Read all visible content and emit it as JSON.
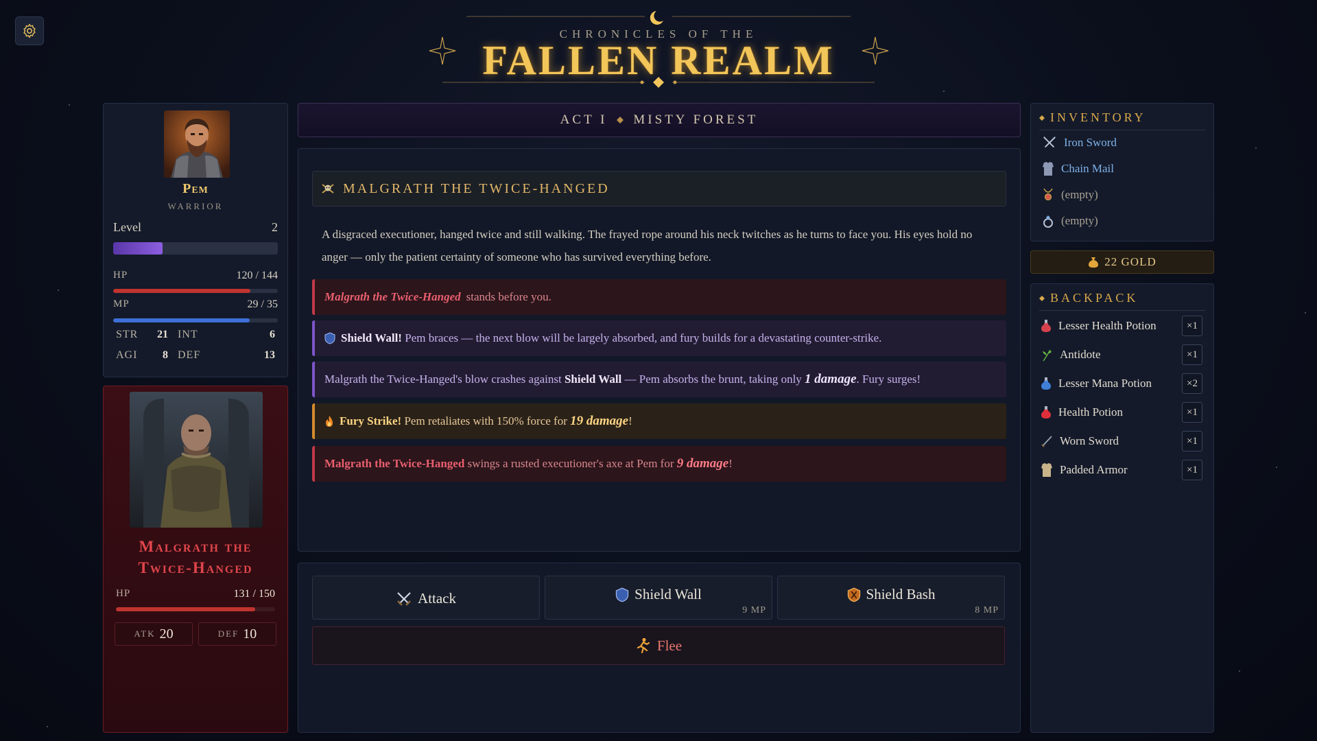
{
  "header": {
    "subtitle": "CHRONICLES OF THE",
    "title": "FALLEN REALM"
  },
  "location": {
    "act": "ACT I",
    "place": "MISTY FOREST"
  },
  "player": {
    "name": "Pem",
    "class": "WARRIOR",
    "level_label": "Level",
    "level": "2",
    "xp_fraction": 0.3,
    "hp_label": "HP",
    "hp_text": "120 / 144",
    "hp_fraction": 0.833,
    "mp_label": "MP",
    "mp_text": "29 / 35",
    "mp_fraction": 0.829,
    "stats": {
      "str_label": "STR",
      "str": "21",
      "int_label": "INT",
      "int": "6",
      "agi_label": "AGI",
      "agi": "8",
      "def_label": "DEF",
      "def": "13"
    }
  },
  "enemy": {
    "name_line1": "Malgrath the",
    "name_line2": "Twice-Hanged",
    "hp_label": "HP",
    "hp_text": "131 / 150",
    "hp_fraction": 0.873,
    "atk_label": "ATK",
    "atk": "20",
    "def_label": "DEF",
    "def": "10"
  },
  "combat": {
    "enemy_title": "MALGRATH THE TWICE-HANGED",
    "description": "A disgraced executioner, hanged twice and still walking. The frayed rope around his neck twitches as he turns to face you. His eyes hold no anger — only the patient certainty of someone who has survived everything before.",
    "log": {
      "l1_name": "Malgrath the Twice-Hanged",
      "l1_rest": "stands before you.",
      "l2_bold": "Shield Wall!",
      "l2_rest": "Pem braces — the next blow will be largely absorbed, and fury builds for a devastating counter-strike.",
      "l3_a": "Malgrath the Twice-Hanged's blow crashes against",
      "l3_bold": "Shield Wall",
      "l3_b": "— Pem absorbs the brunt, taking only",
      "l3_dmg": "1 damage",
      "l3_c": ". Fury surges!",
      "l4_bold": "Fury Strike!",
      "l4_a": "Pem retaliates with 150% force for",
      "l4_dmg": "19 damage",
      "l4_c": "!",
      "l5_name": "Malgrath the Twice-Hanged",
      "l5_a": "swings a rusted executioner's axe at Pem for",
      "l5_dmg": "9 damage",
      "l5_c": "!"
    }
  },
  "actions": {
    "attack": "Attack",
    "shield_wall": "Shield Wall",
    "shield_wall_cost": "9 MP",
    "shield_bash": "Shield Bash",
    "shield_bash_cost": "8 MP",
    "flee": "Flee"
  },
  "inventory": {
    "title": "INVENTORY",
    "weapon": "Iron Sword",
    "armor": "Chain Mail",
    "amulet": "(empty)",
    "ring": "(empty)",
    "gold": "22 GOLD"
  },
  "backpack": {
    "title": "BACKPACK",
    "items": [
      {
        "name": "Lesser Health Potion",
        "qty": "×1"
      },
      {
        "name": "Antidote",
        "qty": "×1"
      },
      {
        "name": "Lesser Mana Potion",
        "qty": "×2"
      },
      {
        "name": "Health Potion",
        "qty": "×1"
      },
      {
        "name": "Worn Sword",
        "qty": "×1"
      },
      {
        "name": "Padded Armor",
        "qty": "×1"
      }
    ]
  },
  "colors": {
    "gold": "#f3c65a",
    "hp_bar": "#c0342f",
    "mp_bar": "#3d6fd6",
    "xp_bar": "#7a4fc9",
    "enemy_red": "#e0464c"
  }
}
